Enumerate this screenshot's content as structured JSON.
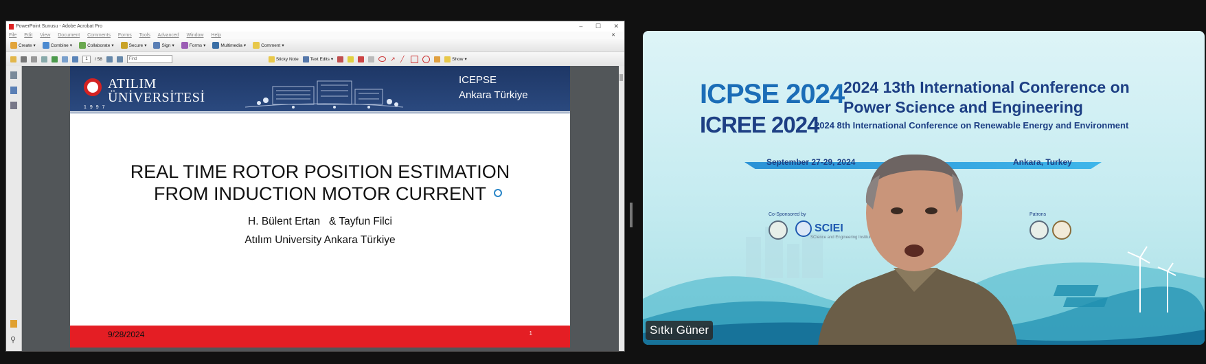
{
  "window": {
    "title": "PowerPoint Sunusu - Adobe Acrobat Pro",
    "controls": [
      "–",
      "☐",
      "✕"
    ]
  },
  "menu": [
    "File",
    "Edit",
    "View",
    "Document",
    "Comments",
    "Forms",
    "Tools",
    "Advanced",
    "Window",
    "Help"
  ],
  "toolbar1": {
    "create": "Create",
    "combine": "Combine",
    "collaborate": "Collaborate",
    "secure": "Secure",
    "sign": "Sign",
    "forms": "Forms",
    "multimedia": "Multimedia",
    "comment": "Comment"
  },
  "toolbar2": {
    "page_current": "1",
    "page_total": "/ 58",
    "find_placeholder": "Find",
    "sticky_note": "Sticky Note",
    "text_edits": "Text Edits",
    "show": "Show"
  },
  "slide": {
    "header": {
      "university_line1": "ATILIM",
      "university_line2": "ÜNİVERSİTESİ",
      "year": "1997",
      "conference": "ICEPSE",
      "location": "Ankara Türkiye"
    },
    "title_line1": "REAL TIME ROTOR POSITION ESTIMATION",
    "title_line2": "FROM INDUCTION MOTOR CURRENT",
    "authors": "H. Bülent Ertan   & Tayfun Filci",
    "affiliation": "Atılım University Ankara Türkiye",
    "date": "9/28/2024",
    "page_number": "1"
  },
  "video": {
    "conf_a": "ICPSE 2024",
    "conf_a_title_1": "2024 13th International Conference on",
    "conf_a_title_2": "Power Science and Engineering",
    "conf_b": "ICREE 2024",
    "conf_b_title": "2024 8th International Conference on Renewable Energy and Environment",
    "dates": "September 27-29, 2024",
    "place": "Ankara, Turkey",
    "co_sponsored": "Co-Sponsored by",
    "sciei": "SCIEI",
    "sciei_sub": "SCIence and Engineering Institute",
    "patrons": "Patrons",
    "participant_name": "Sıtkı Güner"
  }
}
